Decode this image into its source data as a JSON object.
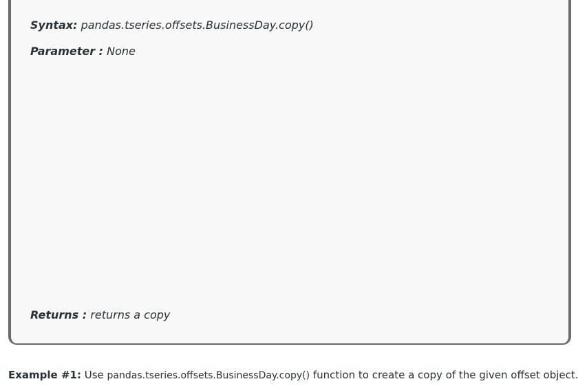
{
  "definition": {
    "syntax_label": "Syntax:",
    "syntax_value": "pandas.tseries.offsets.BusinessDay.copy()",
    "parameter_label": "Parameter :",
    "parameter_value": "None",
    "returns_label": "Returns :",
    "returns_value": "returns a copy"
  },
  "example": {
    "label": "Example #1:",
    "prefix": "Use",
    "code": "pandas.tseries.offsets.BusinessDay.copy()",
    "suffix": "function to create a copy of the given offset object."
  }
}
